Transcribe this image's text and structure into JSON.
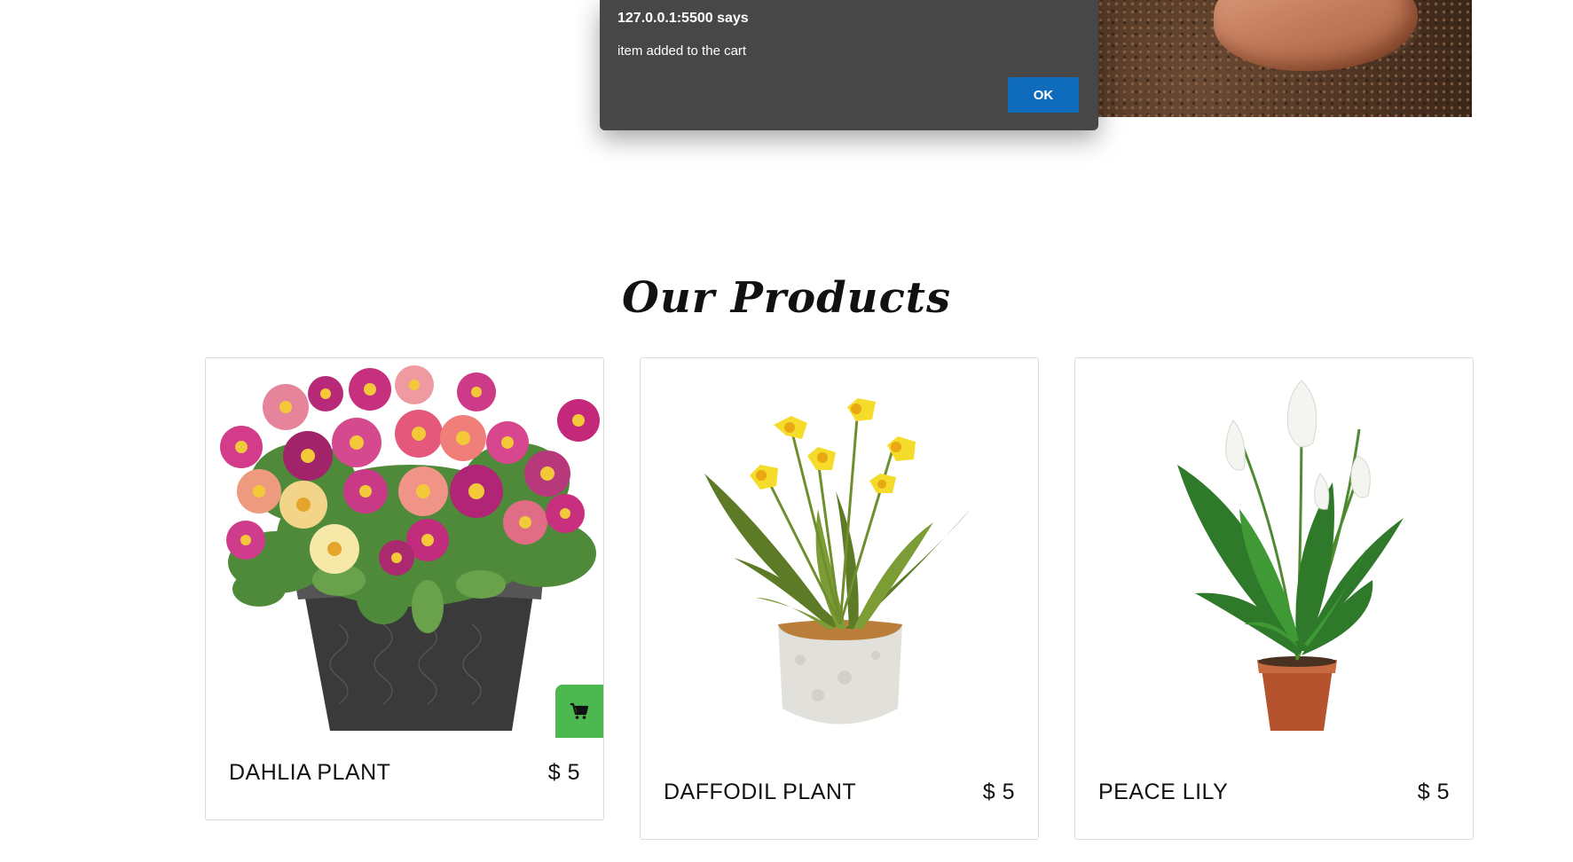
{
  "dialog": {
    "title": "127.0.0.1:5500 says",
    "message": "item added to the cart",
    "ok_label": "OK",
    "ok_color": "#0f6cbd"
  },
  "products_section": {
    "title": "Our Products"
  },
  "products": [
    {
      "name": "DAHLIA PLANT",
      "price": "$ 5",
      "image": "dahlia-plant-image"
    },
    {
      "name": "DAFFODIL PLANT",
      "price": "$ 5",
      "image": "daffodil-plant-image"
    },
    {
      "name": "PEACE LILY",
      "price": "$ 5",
      "image": "peace-lily-image"
    }
  ],
  "cart_button": {
    "icon": "cart-icon",
    "color": "#4cb84f"
  }
}
